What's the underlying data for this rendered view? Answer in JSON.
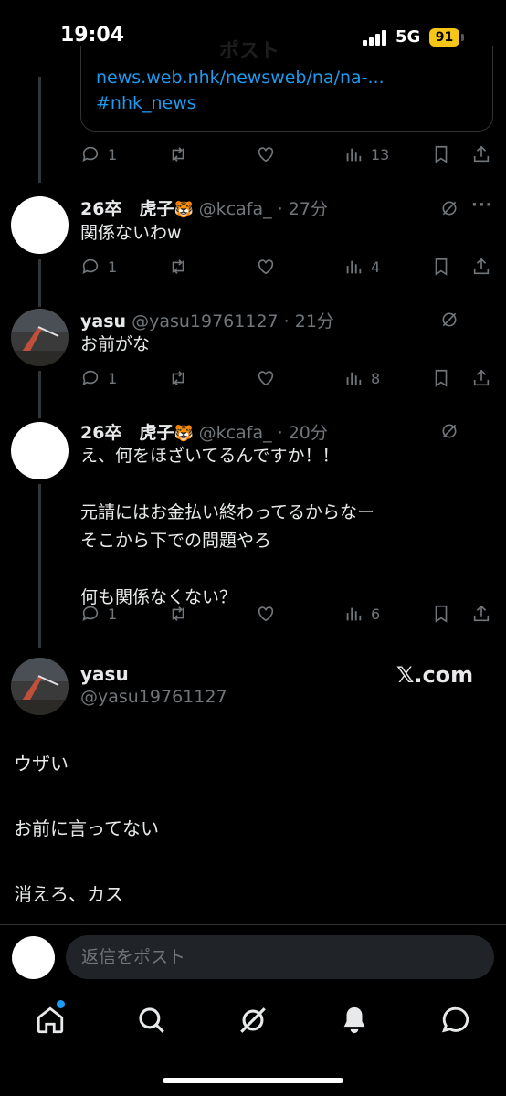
{
  "status_bar": {
    "time": "19:04",
    "network": "5G",
    "battery": "91",
    "ghost_title": "ポスト"
  },
  "quoted_card": {
    "link": "news.web.nhk/newsweb/na/na-...",
    "hashtag": "#nhk_news"
  },
  "posts": [
    {
      "actions": {
        "reply": "1",
        "views": "13"
      }
    },
    {
      "name": "26卒　虎子",
      "emoji": "🐯",
      "meta": "@kcafa_ · 27分",
      "text": "関係ないわw",
      "actions": {
        "reply": "1",
        "views": "4"
      }
    },
    {
      "name": "yasu",
      "meta": "@yasu19761127 · 21分",
      "text": "お前がな",
      "actions": {
        "reply": "1",
        "views": "8"
      }
    },
    {
      "name": "26卒　虎子",
      "emoji": "🐯",
      "meta": "@kcafa_ · 20分",
      "text": "え、何をほざいてるんですか！！\n\n元請にはお金払い終わってるからなー\nそこから下での問題やろ\n\n何も関係なくない？",
      "actions": {
        "reply": "1",
        "views": "6"
      }
    }
  ],
  "main_post": {
    "name": "yasu",
    "handle": "@yasu19761127",
    "watermark": "𝕏.com",
    "lines": [
      "ウザい",
      "お前に言ってない",
      "消えろ、カス"
    ]
  },
  "reply_bar": {
    "placeholder": "返信をポスト"
  },
  "colors": {
    "accent": "#1d9bf0",
    "muted": "#71767b",
    "text": "#e7e9ea",
    "background": "#000000",
    "battery": "#f5c518"
  },
  "icons": {
    "action_row": [
      "reply-icon",
      "repost-icon",
      "like-icon",
      "views-icon",
      "bookmark-icon",
      "share-icon"
    ],
    "tab_bar": [
      "home-icon",
      "search-icon",
      "grok-icon",
      "notifications-icon",
      "messages-icon"
    ]
  }
}
